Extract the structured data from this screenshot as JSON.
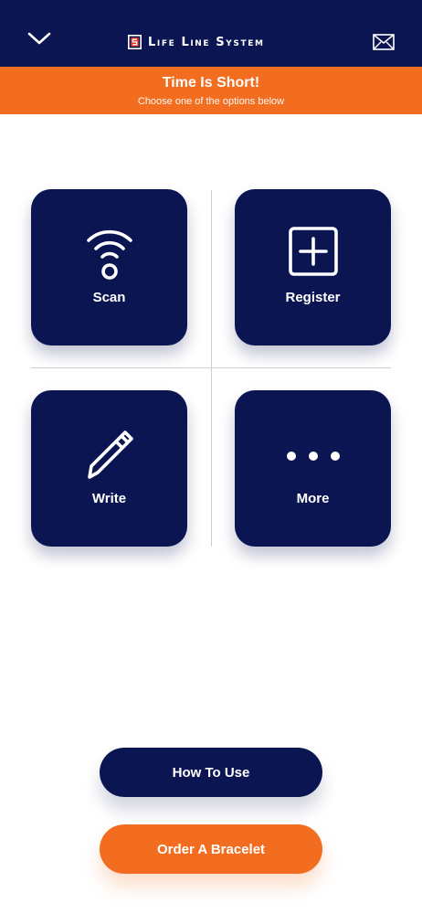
{
  "header": {
    "app_title": "Life Line System",
    "back_icon": "chevron-down-icon",
    "mail_icon": "mail-icon"
  },
  "banner": {
    "title": "Time Is Short!",
    "subtitle": "Choose one of the options below"
  },
  "tiles": [
    {
      "label": "Scan",
      "icon": "nfc-scan-icon"
    },
    {
      "label": "Register",
      "icon": "plus-square-icon"
    },
    {
      "label": "Write",
      "icon": "pencil-icon"
    },
    {
      "label": "More",
      "icon": "more-dots-icon"
    }
  ],
  "buttons": {
    "how_to_use": "How To Use",
    "order_bracelet": "Order A Bracelet"
  },
  "colors": {
    "navy": "#0a1552",
    "orange": "#f36d21",
    "background": "#ffffff"
  }
}
